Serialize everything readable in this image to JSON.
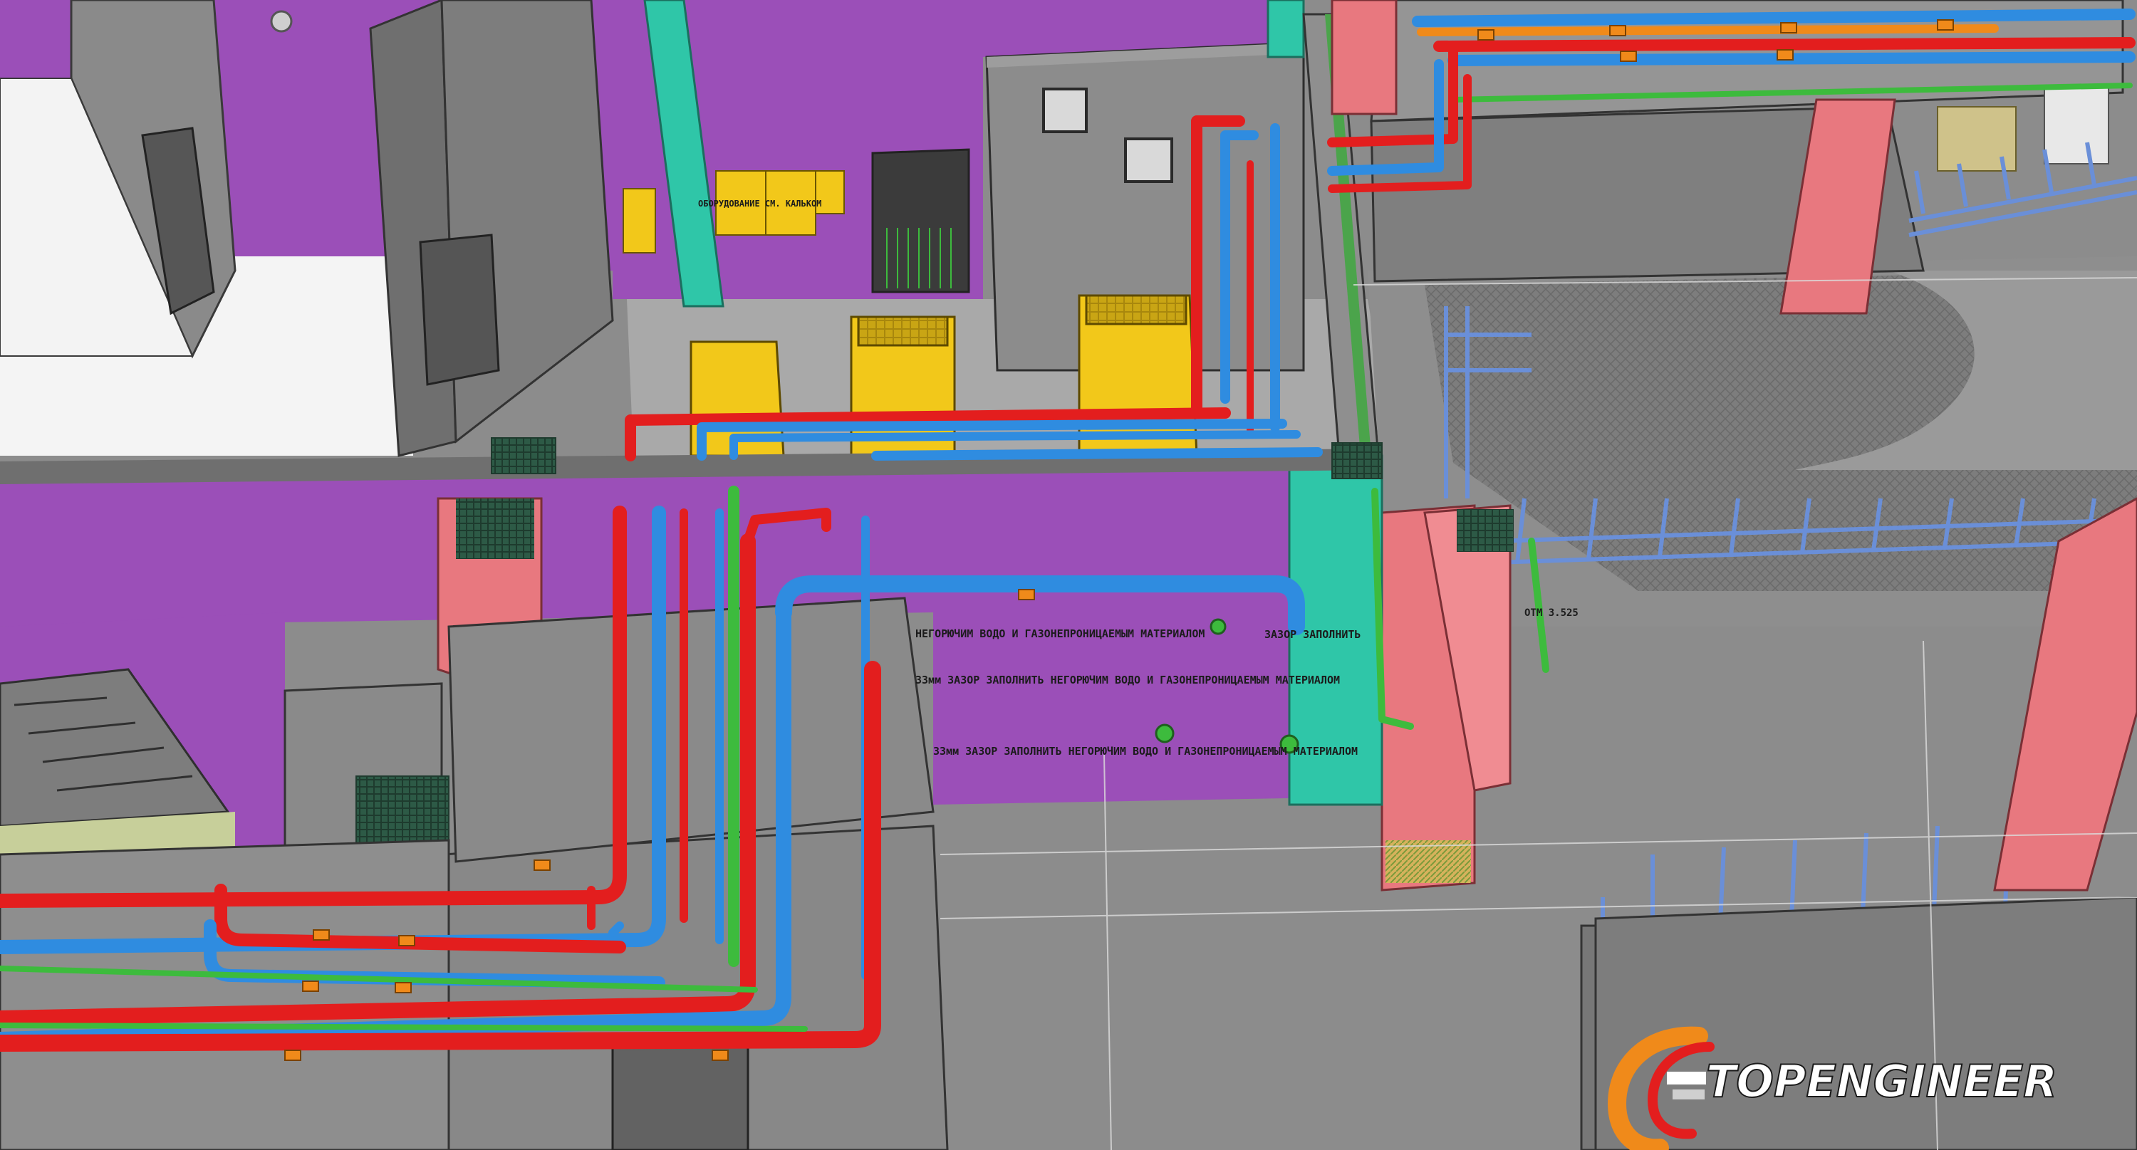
{
  "model": {
    "annotations": [
      {
        "id": "gap-note-1",
        "text": "33мм ЗАЗОР ЗАПОЛНИТЬ НЕГОРЮЧИМ ВОДО И ГАЗОНЕПРОНИЦАЕМЫМ МАТЕРИАЛОМ"
      },
      {
        "id": "gap-note-2",
        "text": "33мм ЗАЗОР ЗАПОЛНИТЬ НЕГОРЮЧИМ ВОДО И ГАЗОНЕПРОНИЦАЕМЫМ МАТЕРИАЛОМ"
      },
      {
        "id": "gap-note-3",
        "text": "ЗАЗОР ЗАПОЛНИТЬ"
      },
      {
        "id": "gap-note-4",
        "text": "НЕГОРЮЧИМ ВОДО И ГАЗОНЕПРОНИЦАЕМЫМ МАТЕРИАЛОМ"
      },
      {
        "id": "equip-note-1",
        "text": "ОБОРУДОВАНИЕ СМ. КАЛЬКОМ"
      },
      {
        "id": "partition-note",
        "text": "ОТМ 3.525"
      }
    ],
    "colors": {
      "wall_purple": "#9b4fb8",
      "concrete": "#8e8e8e",
      "pipe_supply_red": "#e31e1e",
      "pipe_return_blue": "#2f8ce0",
      "pipe_green": "#3dbb3d",
      "pipe_orange": "#f08a1a",
      "column_pink": "#e8787f",
      "column_teal": "#2fc6a8",
      "equipment_yellow": "#f2c81a"
    },
    "icons": [
      "topengineer-logo-icon"
    ]
  },
  "watermark": {
    "brand": "TOPENGINEER"
  }
}
